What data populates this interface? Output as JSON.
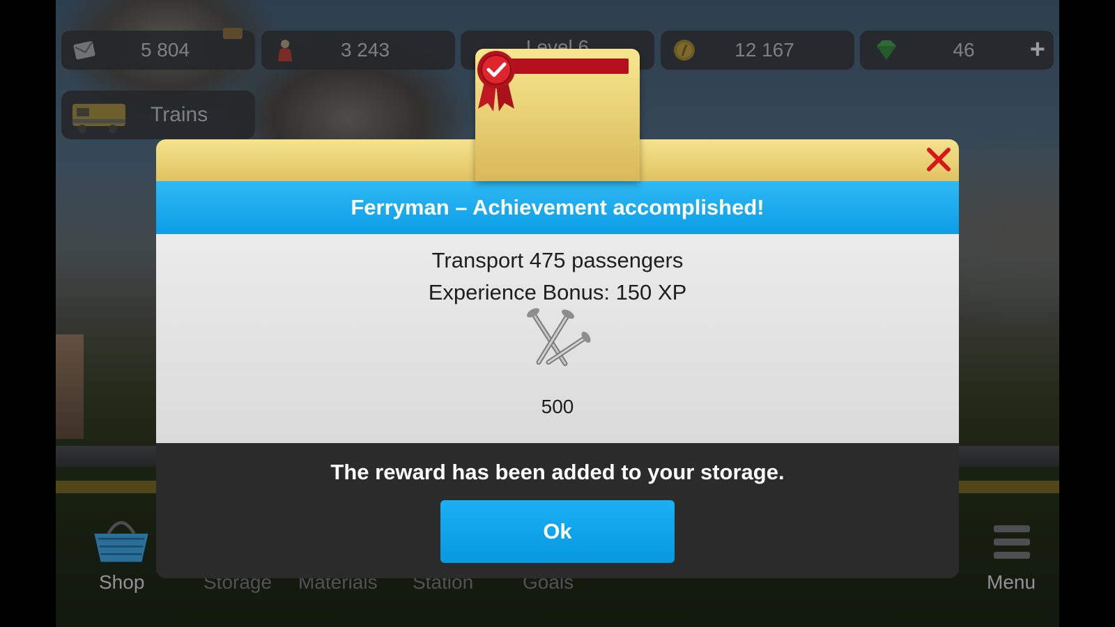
{
  "hud": {
    "mail_value": "5 804",
    "passengers_value": "3 243",
    "level_text": "Level 6",
    "coins_value": "12 167",
    "gems_value": "46",
    "add_label": "+"
  },
  "trains_button": {
    "label": "Trains"
  },
  "nav": {
    "shop": "Shop",
    "storage": "Storage",
    "materials": "Materials",
    "station": "Station",
    "goals": "Goals",
    "menu": "Menu"
  },
  "modal": {
    "title": "Ferryman – Achievement accomplished!",
    "task": "Transport 475 passengers",
    "bonus": "Experience Bonus:  150 XP",
    "reward_icon": "nails-icon",
    "reward_quantity": "500",
    "footer_message": "The reward has been added to your storage.",
    "ok_label": "Ok"
  },
  "colors": {
    "title_bar": "#14a9ef",
    "ok_button": "#0ea5ec",
    "gold": "#efd67a",
    "close_x": "#d9141b",
    "ribbon": "#b40f1a"
  }
}
